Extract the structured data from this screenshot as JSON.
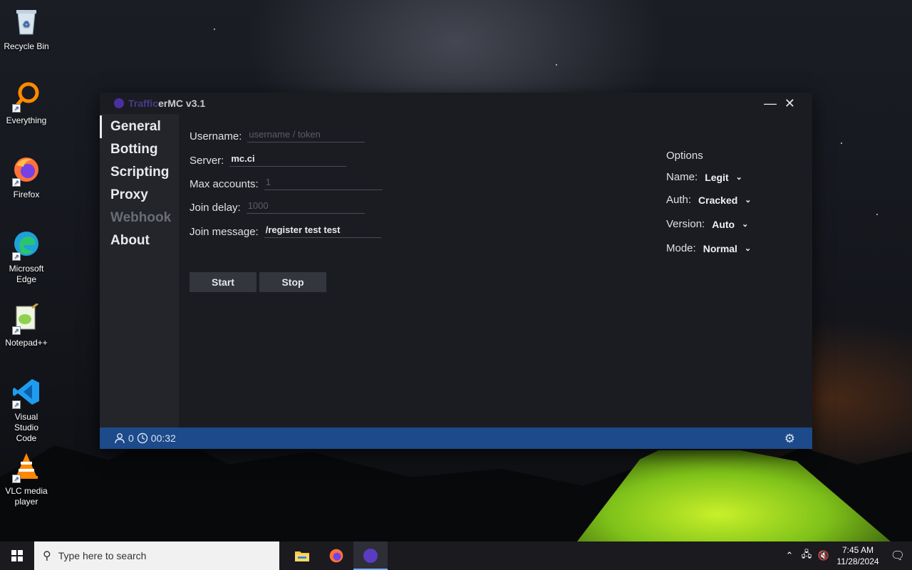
{
  "desktop": {
    "icons": [
      {
        "label": "Recycle Bin",
        "icon": "recycle-bin-icon"
      },
      {
        "label": "Everything",
        "icon": "everything-search-icon"
      },
      {
        "label": "Firefox",
        "icon": "firefox-icon"
      },
      {
        "label": "Microsoft Edge",
        "icon": "edge-icon"
      },
      {
        "label": "Notepad++",
        "icon": "notepadpp-icon"
      },
      {
        "label": "Visual Studio Code",
        "icon": "vscode-icon"
      },
      {
        "label": "VLC media player",
        "icon": "vlc-icon"
      }
    ]
  },
  "app": {
    "title_prefix": "Traffic",
    "title_rest": "erMC v3.1",
    "minimize": "—",
    "close": "✕",
    "nav": [
      {
        "label": "General",
        "state": "active"
      },
      {
        "label": "Botting",
        "state": "normal"
      },
      {
        "label": "Scripting",
        "state": "normal"
      },
      {
        "label": "Proxy",
        "state": "normal"
      },
      {
        "label": "Webhook",
        "state": "disabled"
      },
      {
        "label": "About",
        "state": "normal"
      }
    ],
    "form": {
      "username": {
        "label": "Username:",
        "value": "",
        "placeholder": "username / token"
      },
      "server": {
        "label": "Server:",
        "value": "mc.ci"
      },
      "max_accounts": {
        "label": "Max accounts:",
        "value": "",
        "placeholder": "1"
      },
      "join_delay": {
        "label": "Join delay:",
        "value": "",
        "placeholder": "1000"
      },
      "join_message": {
        "label": "Join message:",
        "value": "/register test test"
      }
    },
    "buttons": {
      "start": "Start",
      "stop": "Stop"
    },
    "options": {
      "heading": "Options",
      "name": {
        "label": "Name:",
        "value": "Legit"
      },
      "auth": {
        "label": "Auth:",
        "value": "Cracked"
      },
      "version": {
        "label": "Version:",
        "value": "Auto"
      },
      "mode": {
        "label": "Mode:",
        "value": "Normal"
      }
    },
    "status": {
      "count": "0",
      "timer": "00:32"
    }
  },
  "taskbar": {
    "search_placeholder": "Type here to search",
    "time": "7:45 AM",
    "date": "11/28/2024"
  },
  "colors": {
    "accent": "#1c4a8a",
    "window_bg": "#1b1c22",
    "sidebar_bg": "#23252b"
  }
}
